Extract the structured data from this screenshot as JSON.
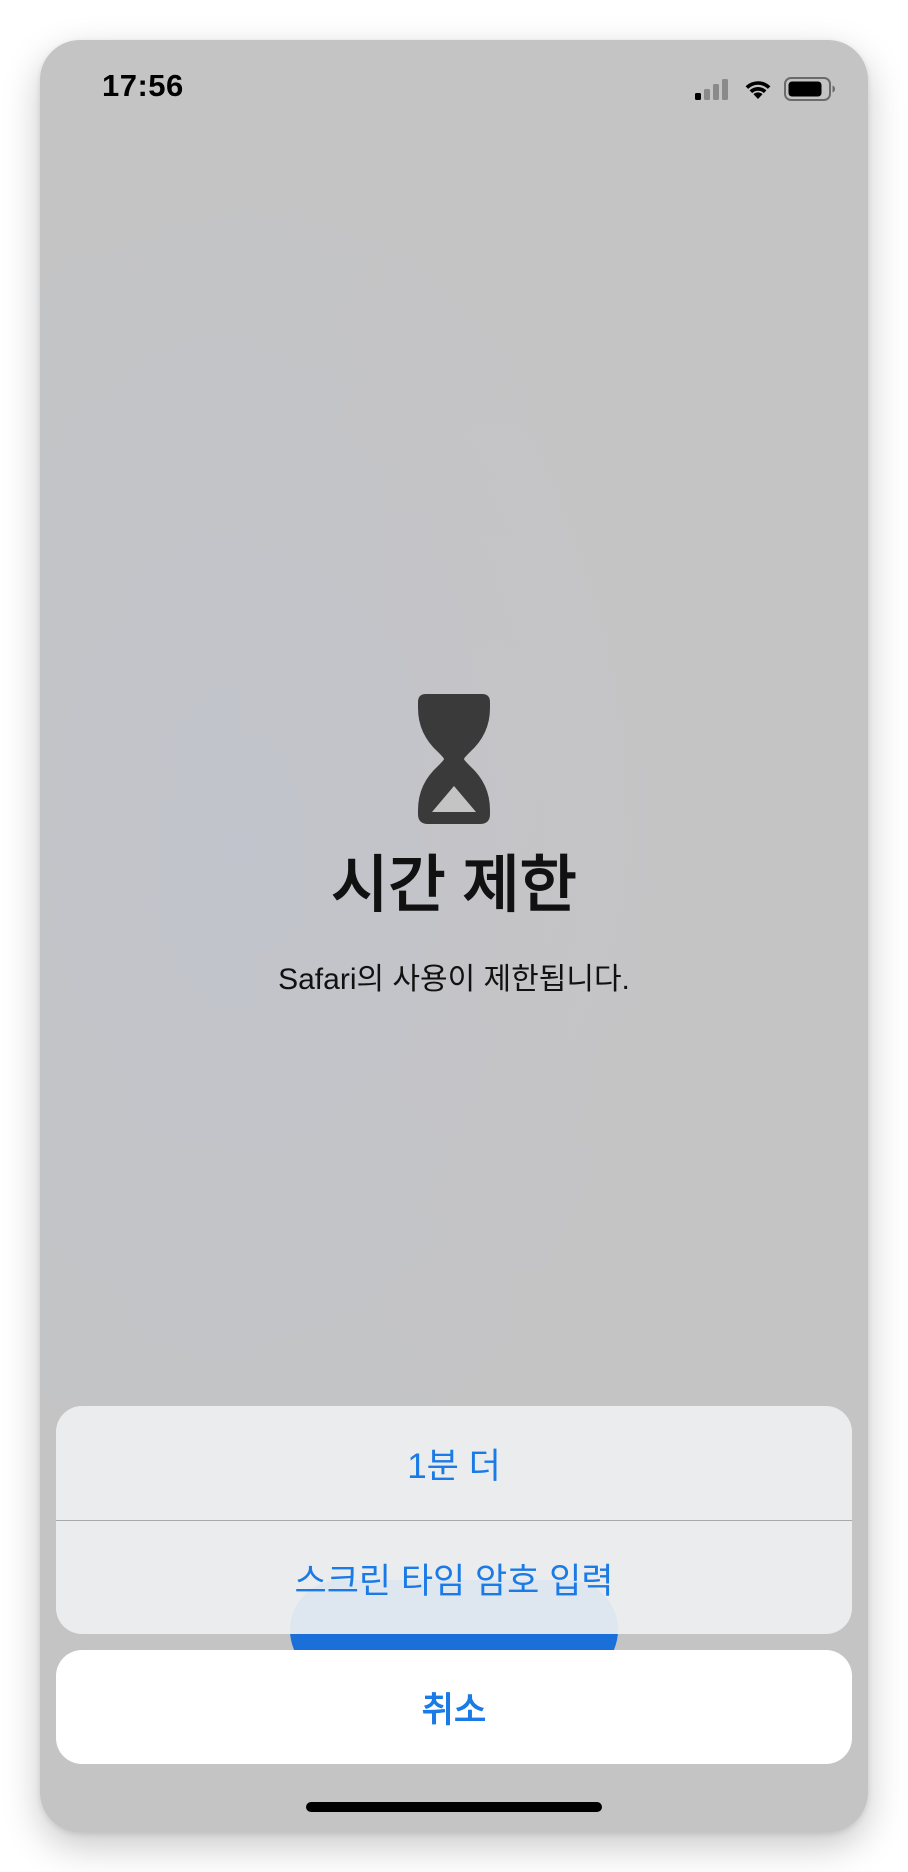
{
  "status_bar": {
    "time": "17:56",
    "icons": [
      "cellular-signal-icon",
      "wifi-icon",
      "battery-icon"
    ]
  },
  "screen_time": {
    "icon": "hourglass-icon",
    "title": "시간 제한",
    "message": "Safari의 사용이 제한됩니다."
  },
  "action_sheet": {
    "one_more_minute_label": "1분 더",
    "enter_passcode_label": "스크린 타임 암호 입력",
    "cancel_label": "취소"
  },
  "colors": {
    "accent": "#1a7ae6",
    "background": "#c4c4c4",
    "sheet_background": "#edeff1",
    "hourglass": "#3a3a3a"
  }
}
